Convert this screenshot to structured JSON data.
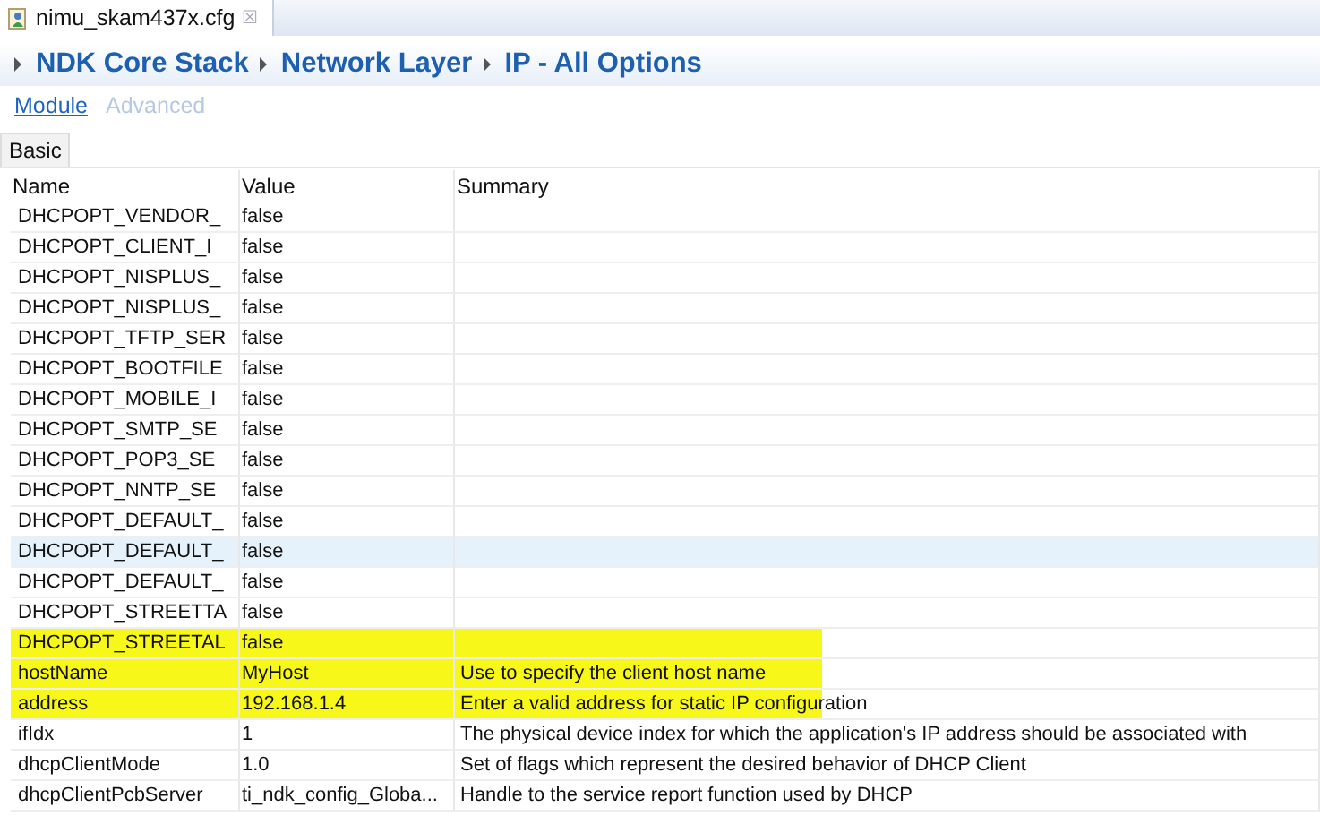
{
  "editor_tab": {
    "label": "nimu_skam437x.cfg",
    "close": "☒"
  },
  "breadcrumb": [
    "NDK Core Stack",
    "Network Layer",
    "IP - All Options"
  ],
  "view_links": [
    {
      "label": "Module",
      "selected": true
    },
    {
      "label": "Advanced",
      "selected": false
    }
  ],
  "section_tabs": [
    {
      "label": "Basic",
      "selected": true
    }
  ],
  "table": {
    "columns": [
      "Name",
      "Value",
      "Summary"
    ],
    "rows": [
      {
        "name": "DHCPOPT_VENDOR_",
        "value": "false",
        "summary": "",
        "selected": false,
        "highlighted": false
      },
      {
        "name": "DHCPOPT_CLIENT_I",
        "value": "false",
        "summary": "",
        "selected": false,
        "highlighted": false
      },
      {
        "name": "DHCPOPT_NISPLUS_",
        "value": "false",
        "summary": "",
        "selected": false,
        "highlighted": false
      },
      {
        "name": "DHCPOPT_NISPLUS_",
        "value": "false",
        "summary": "",
        "selected": false,
        "highlighted": false
      },
      {
        "name": "DHCPOPT_TFTP_SER",
        "value": "false",
        "summary": "",
        "selected": false,
        "highlighted": false
      },
      {
        "name": "DHCPOPT_BOOTFILE",
        "value": "false",
        "summary": "",
        "selected": false,
        "highlighted": false
      },
      {
        "name": "DHCPOPT_MOBILE_I",
        "value": "false",
        "summary": "",
        "selected": false,
        "highlighted": false
      },
      {
        "name": "DHCPOPT_SMTP_SE",
        "value": "false",
        "summary": "",
        "selected": false,
        "highlighted": false
      },
      {
        "name": "DHCPOPT_POP3_SE",
        "value": "false",
        "summary": "",
        "selected": false,
        "highlighted": false
      },
      {
        "name": "DHCPOPT_NNTP_SE",
        "value": "false",
        "summary": "",
        "selected": false,
        "highlighted": false
      },
      {
        "name": "DHCPOPT_DEFAULT_",
        "value": "false",
        "summary": "",
        "selected": false,
        "highlighted": false
      },
      {
        "name": "DHCPOPT_DEFAULT_",
        "value": "false",
        "summary": "",
        "selected": true,
        "highlighted": false
      },
      {
        "name": "DHCPOPT_DEFAULT_",
        "value": "false",
        "summary": "",
        "selected": false,
        "highlighted": false
      },
      {
        "name": "DHCPOPT_STREETTA",
        "value": "false",
        "summary": "",
        "selected": false,
        "highlighted": false
      },
      {
        "name": "DHCPOPT_STREETAL",
        "value": "false",
        "summary": "",
        "selected": false,
        "highlighted": true
      },
      {
        "name": "hostName",
        "value": "MyHost",
        "summary": "Use to specify the client host name",
        "selected": false,
        "highlighted": true
      },
      {
        "name": "address",
        "value": "192.168.1.4",
        "summary": "Enter a valid address for static IP configuration",
        "selected": false,
        "highlighted": true
      },
      {
        "name": "ifIdx",
        "value": "1",
        "summary": "The physical device index for which the application's IP address should  be associated with",
        "selected": false,
        "highlighted": false
      },
      {
        "name": "dhcpClientMode",
        "value": "1.0",
        "summary": "Set of flags which represent the desired behavior of DHCP Client",
        "selected": false,
        "highlighted": false
      },
      {
        "name": "dhcpClientPcbServer",
        "value": "ti_ndk_config_Globa...",
        "summary": "Handle to the service report function used by DHCP",
        "selected": false,
        "highlighted": false
      }
    ]
  }
}
